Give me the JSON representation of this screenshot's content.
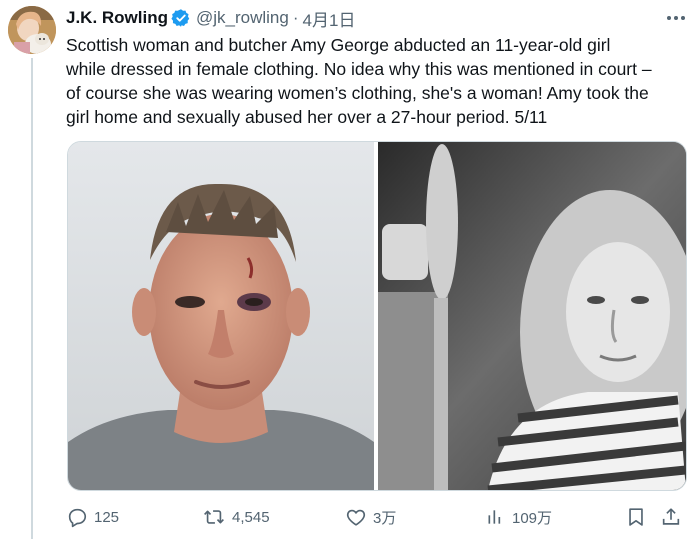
{
  "tweet": {
    "author": {
      "name": "J.K. Rowling",
      "handle": "@jk_rowling",
      "verified": true,
      "avatar": "avatar"
    },
    "separator": "·",
    "date": "4月1日",
    "text_lines": [
      "Scottish woman and butcher Amy George abducted an 11-year-old girl",
      "while dressed in female clothing. No idea why this was mentioned in court –",
      "of course she was wearing women’s clothing, she's a woman! Amy took the",
      "girl home and sexually abused her over a 27-hour period. 5/11"
    ],
    "media": [
      {
        "icon": "photo",
        "tone": "color mugshot on grey background"
      },
      {
        "icon": "photo",
        "tone": "black-and-white portrait"
      }
    ],
    "actions": {
      "reply": {
        "icon": "reply-icon",
        "count": "125"
      },
      "repost": {
        "icon": "repost-icon",
        "count": "4,545"
      },
      "like": {
        "icon": "like-icon",
        "count": "3万"
      },
      "views": {
        "icon": "views-icon",
        "count": "109万"
      },
      "bookmark": {
        "icon": "bookmark-icon"
      },
      "share": {
        "icon": "share-icon"
      }
    }
  },
  "colors": {
    "text": "#0f1419",
    "secondary": "#536471",
    "verified": "#1d9bf0",
    "border": "#cfd9de"
  }
}
